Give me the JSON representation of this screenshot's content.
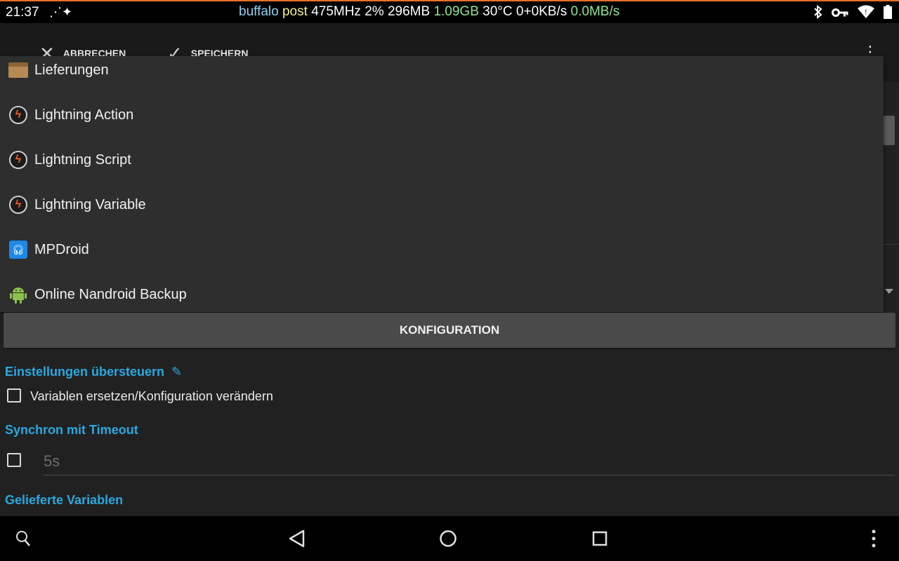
{
  "status_bar": {
    "time": "21:37",
    "stats": [
      {
        "text": "buffalo ",
        "color": "#8fd3f5"
      },
      {
        "text": "post ",
        "color": "#f5f08f"
      },
      {
        "text": "475MHz ",
        "color": "#ffffff"
      },
      {
        "text": "2% ",
        "color": "#ffffff"
      },
      {
        "text": "296MB ",
        "color": "#ffffff"
      },
      {
        "text": "1.09GB ",
        "color": "#8fe68f"
      },
      {
        "text": "30°C ",
        "color": "#ffffff"
      },
      {
        "text": "0+0KB/s ",
        "color": "#ffffff"
      },
      {
        "text": "0.0MB/s",
        "color": "#8fe68f"
      }
    ]
  },
  "action_bar": {
    "cancel_label": "ABBRECHEN",
    "save_label": "SPEICHERN"
  },
  "popup": {
    "items": [
      {
        "label": "Lieferungen",
        "icon": "package-icon"
      },
      {
        "label": "Lightning Action",
        "icon": "lightning-icon"
      },
      {
        "label": "Lightning Script",
        "icon": "lightning-icon"
      },
      {
        "label": "Lightning Variable",
        "icon": "lightning-icon"
      },
      {
        "label": "MPDroid",
        "icon": "headphones-icon"
      },
      {
        "label": "Online Nandroid Backup",
        "icon": "android-icon"
      }
    ]
  },
  "config_button_label": "KONFIGURATION",
  "override_section": {
    "header": "Einstellungen übersteuern",
    "checkbox_label": "Variablen ersetzen/Konfiguration verändern",
    "checked": false
  },
  "timeout_section": {
    "header": "Synchron mit Timeout",
    "checked": false,
    "placeholder": "5s"
  },
  "variables_section": {
    "header": "Gelieferte Variablen"
  },
  "colors": {
    "accent": "#2aa8e0",
    "lightning": "#ff5a1a"
  }
}
